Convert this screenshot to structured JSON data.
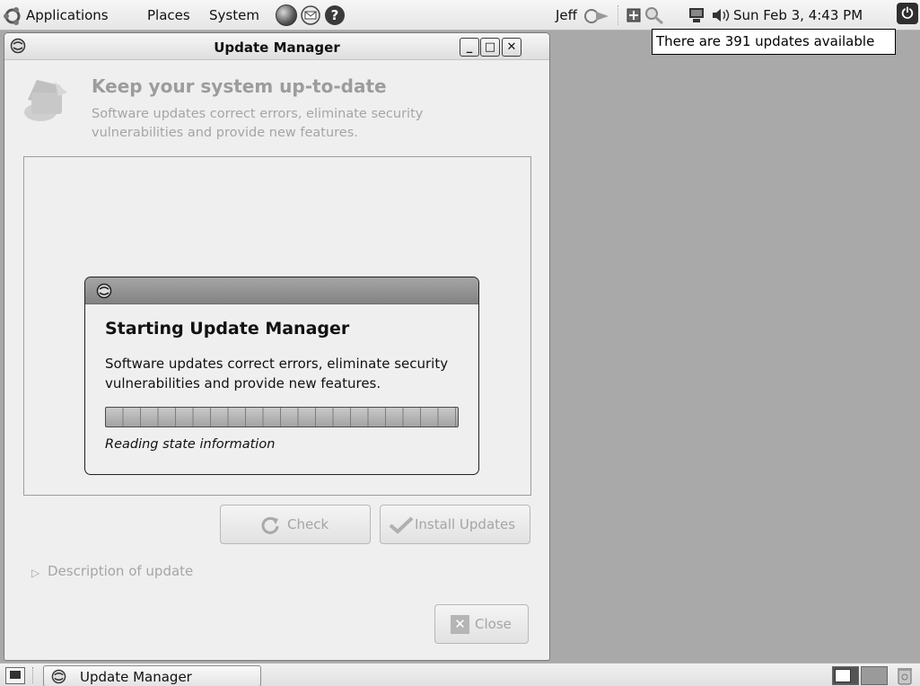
{
  "top_panel": {
    "menus": [
      "Applications",
      "Places",
      "System"
    ],
    "user": "Jeff",
    "clock": "Sun Feb  3,  4:43 PM",
    "tooltip": "There are 391 updates available"
  },
  "window": {
    "title": "Update Manager",
    "controls": {
      "minimize": "_",
      "maximize": "□",
      "close": "✕"
    },
    "header": {
      "title": "Keep your system up-to-date",
      "description": "Software updates correct errors, eliminate security vulnerabilities and provide new features."
    },
    "dialog": {
      "heading": "Starting Update Manager",
      "description": "Software updates correct errors, eliminate security vulnerabilities and provide new features.",
      "status": "Reading state information"
    },
    "buttons": {
      "check": "Check",
      "install": "Install Updates",
      "close": "Close"
    },
    "expander": "Description of update"
  },
  "taskbar": {
    "task_label": "Update Manager"
  },
  "colors": {
    "desktop": "#a9a9a9",
    "panel": "#e6e6e6",
    "dialog_titlebar": "#8f8f8f",
    "disabled_text": "#a5a5a5"
  }
}
